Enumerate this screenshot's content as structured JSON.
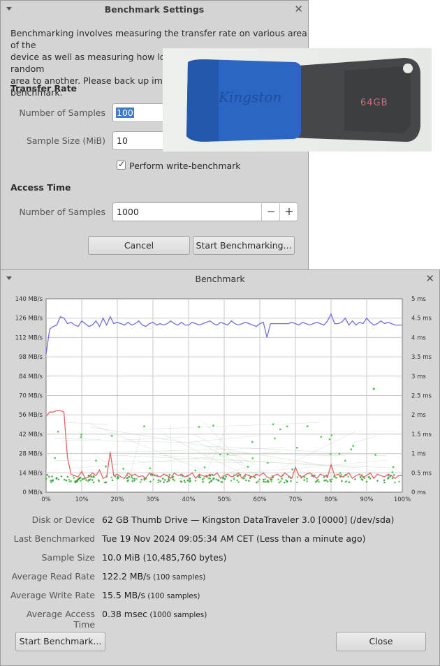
{
  "settings": {
    "title": "Benchmark Settings",
    "description_lines": [
      "Benchmarking involves measuring the transfer rate on various area of the",
      "device as well as measuring how long it takes to seek from one random",
      "area to another. Please back up importa",
      "benchmark."
    ],
    "transfer_rate_heading": "Transfer Rate",
    "num_samples_label": "Number of Samples",
    "num_samples_value": "100",
    "sample_size_label": "Sample Size (MiB)",
    "sample_size_value": "10",
    "write_benchmark_label": "Perform write-benchmark",
    "write_benchmark_checked": true,
    "access_time_heading": "Access Time",
    "access_samples_label": "Number of Samples",
    "access_samples_value": "1000",
    "minus_label": "−",
    "plus_label": "+",
    "cancel_label": "Cancel",
    "start_label": "Start Benchmarking..."
  },
  "photo": {
    "brand_text": "Kingston",
    "capacity_text": "64GB",
    "body_color": "#45484a",
    "cap_color": "#2b66c4"
  },
  "benchmark": {
    "title": "Benchmark",
    "fields": [
      {
        "label": "Disk or Device",
        "value": "62 GB Thumb Drive — Kingston DataTraveler 3.0 [0000] (/dev/sda)",
        "note": ""
      },
      {
        "label": "Last Benchmarked",
        "value": "Tue 19 Nov 2024 09:05:34 AM CET (Less than a minute ago)",
        "note": ""
      },
      {
        "label": "Sample Size",
        "value": "10.0 MiB (10,485,760 bytes)",
        "note": ""
      },
      {
        "label": "Average Read Rate",
        "value": "122.2 MB/s",
        "note": "(100 samples)"
      },
      {
        "label": "Average Write Rate",
        "value": "15.5 MB/s",
        "note": "(100 samples)"
      },
      {
        "label": "Average Access Time",
        "value": "0.38 msec",
        "note": "(1000 samples)"
      }
    ],
    "start_benchmark_label": "Start Benchmark...",
    "close_label": "Close"
  },
  "chart_data": {
    "type": "line",
    "y_left_ticks": [
      "0 MB/s",
      "14 MB/s",
      "28 MB/s",
      "42 MB/s",
      "56 MB/s",
      "70 MB/s",
      "84 MB/s",
      "98 MB/s",
      "112 MB/s",
      "126 MB/s",
      "140 MB/s"
    ],
    "y_right_ticks": [
      "0 ms",
      "0.5 ms",
      "1 ms",
      "1.5 ms",
      "2 ms",
      "2.5 ms",
      "3 ms",
      "3.5 ms",
      "4 ms",
      "4.5 ms",
      "5 ms"
    ],
    "x_ticks": [
      "0%",
      "10%",
      "20%",
      "30%",
      "40%",
      "50%",
      "60%",
      "70%",
      "80%",
      "90%",
      "100%"
    ],
    "ylim_left": [
      0,
      140
    ],
    "ylim_right": [
      0,
      5
    ],
    "xlim": [
      0,
      100
    ],
    "grid": true,
    "series": [
      {
        "color": "#6f6fe0",
        "x": [
          0,
          1,
          2,
          3,
          4,
          5,
          6,
          7,
          8,
          9,
          10,
          11,
          12,
          13,
          14,
          15,
          16,
          17,
          18,
          19,
          20,
          21,
          22,
          23,
          24,
          25,
          26,
          27,
          28,
          29,
          30,
          31,
          32,
          33,
          34,
          35,
          36,
          37,
          38,
          39,
          40,
          41,
          42,
          43,
          44,
          45,
          46,
          47,
          48,
          49,
          50,
          51,
          52,
          53,
          54,
          55,
          56,
          57,
          58,
          59,
          60,
          61,
          62,
          63,
          64,
          65,
          66,
          67,
          68,
          69,
          70,
          71,
          72,
          73,
          74,
          75,
          76,
          77,
          78,
          79,
          80,
          81,
          82,
          83,
          84,
          85,
          86,
          87,
          88,
          89,
          90,
          91,
          92,
          93,
          94,
          95,
          96,
          97,
          98,
          99,
          100
        ],
        "values": [
          100,
          118,
          120,
          121,
          127,
          126,
          122,
          123,
          121,
          120,
          124,
          122,
          120,
          121,
          124,
          120,
          126,
          121,
          127,
          122,
          123,
          122,
          121,
          123,
          121,
          122,
          124,
          121,
          120,
          122,
          123,
          121,
          122,
          121,
          122,
          124,
          122,
          121,
          123,
          121,
          121,
          123,
          122,
          121,
          122,
          123,
          124,
          122,
          121,
          123,
          122,
          121,
          124,
          122,
          121,
          122,
          123,
          122,
          121,
          120,
          122,
          123,
          112,
          122,
          122,
          122,
          122,
          122,
          122,
          123,
          122,
          121,
          123,
          122,
          121,
          122,
          123,
          122,
          121,
          124,
          129,
          122,
          122,
          123,
          126,
          121,
          124,
          121,
          123,
          122,
          126,
          123,
          121,
          122,
          124,
          122,
          123,
          122,
          121,
          121,
          121
        ]
      },
      {
        "color": "#e06666",
        "x": [
          0,
          1,
          2,
          3,
          4,
          5,
          6,
          7,
          8,
          9,
          10,
          11,
          12,
          13,
          14,
          15,
          16,
          17,
          18,
          19,
          20,
          21,
          22,
          23,
          24,
          25,
          26,
          27,
          28,
          29,
          30,
          31,
          32,
          33,
          34,
          35,
          36,
          37,
          38,
          39,
          40,
          41,
          42,
          43,
          44,
          45,
          46,
          47,
          48,
          49,
          50,
          51,
          52,
          53,
          54,
          55,
          56,
          57,
          58,
          59,
          60,
          61,
          62,
          63,
          64,
          65,
          66,
          67,
          68,
          69,
          70,
          71,
          72,
          73,
          74,
          75,
          76,
          77,
          78,
          79,
          80,
          81,
          82,
          83,
          84,
          85,
          86,
          87,
          88,
          89,
          90,
          91,
          92,
          93,
          94,
          95,
          96,
          97,
          98,
          99,
          100
        ],
        "values": [
          55,
          58,
          58,
          59,
          59,
          58,
          25,
          13,
          12,
          11,
          15,
          10,
          11,
          14,
          12,
          16,
          10,
          11,
          29,
          12,
          13,
          11,
          10,
          14,
          12,
          13,
          11,
          12,
          10,
          14,
          13,
          12,
          11,
          13,
          12,
          10,
          14,
          12,
          13,
          11,
          12,
          14,
          10,
          13,
          12,
          11,
          13,
          12,
          14,
          10,
          12,
          13,
          11,
          12,
          14,
          10,
          13,
          12,
          11,
          13,
          12,
          14,
          11,
          10,
          12,
          13,
          11,
          14,
          12,
          10,
          18,
          12,
          11,
          13,
          14,
          12,
          10,
          13,
          12,
          11,
          20,
          12,
          13,
          11,
          12,
          14,
          10,
          12,
          13,
          11,
          12,
          14,
          10,
          13,
          12,
          11,
          13,
          12,
          10,
          12,
          12
        ]
      }
    ],
    "access_scatter_color": "#49c749"
  }
}
